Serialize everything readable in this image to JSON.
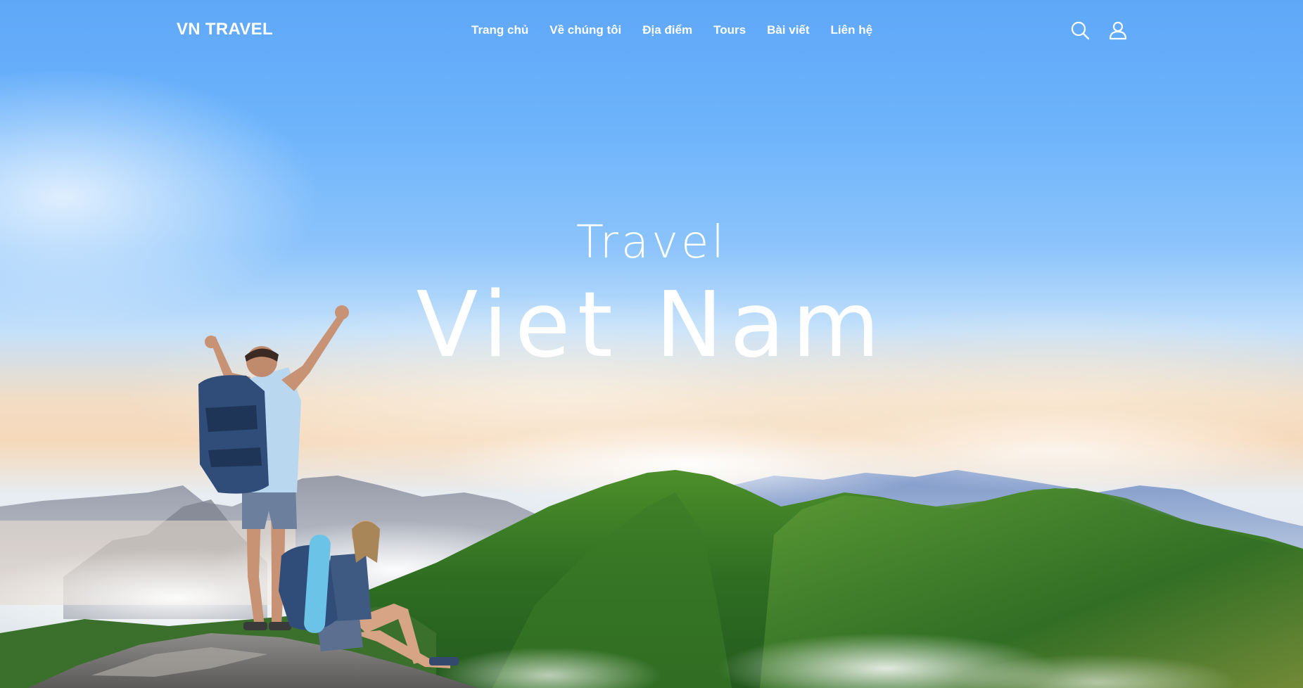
{
  "header": {
    "logo": "VN TRAVEL",
    "nav": [
      {
        "label": "Trang chủ"
      },
      {
        "label": "Về chúng tôi"
      },
      {
        "label": "Địa điểm"
      },
      {
        "label": "Tours"
      },
      {
        "label": "Bài viết"
      },
      {
        "label": "Liên hệ"
      }
    ],
    "icons": [
      "search-icon",
      "user-icon"
    ]
  },
  "hero": {
    "subtitle": "Travel",
    "title": "Viet Nam"
  },
  "colors": {
    "sky_top": "#5fa8f8",
    "text": "#ffffff",
    "mountain_green": "#3f7f2a"
  }
}
